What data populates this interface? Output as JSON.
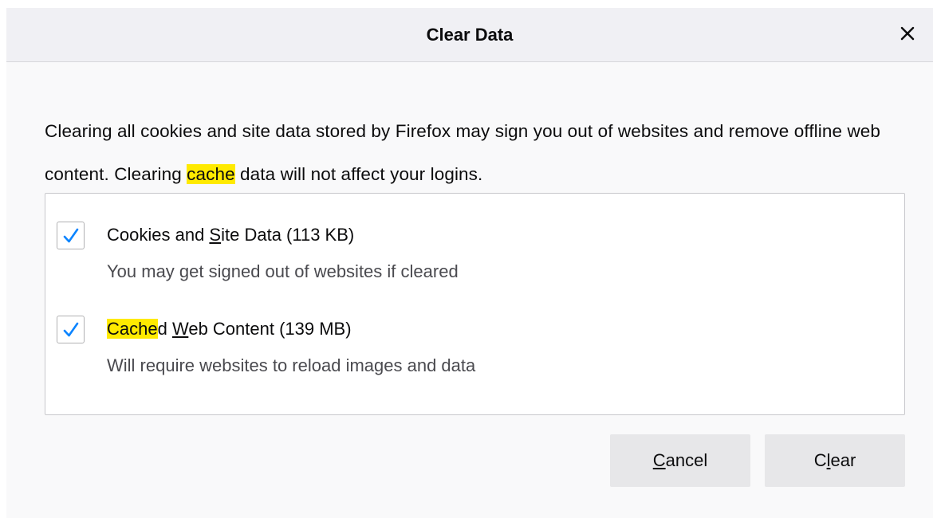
{
  "dialog": {
    "title": "Clear Data",
    "close_icon": "close-icon"
  },
  "description": {
    "part1": "Clearing all cookies and site data stored by Firefox may sign you out of websites and remove offline web content. Clearing ",
    "highlight": "cache",
    "part2": " data will not affect your logins."
  },
  "options": [
    {
      "checked": true,
      "label_pre": "Cookies and ",
      "label_accesskey": "S",
      "label_post": "ite Data (113 KB)",
      "description": "You may get signed out of websites if cleared"
    },
    {
      "checked": true,
      "label_highlight": "Cache",
      "label_pre": "d ",
      "label_accesskey": "W",
      "label_post": "eb Content (139 MB)",
      "description": "Will require websites to reload images and data"
    }
  ],
  "buttons": {
    "cancel": {
      "accesskey": "C",
      "rest": "ancel"
    },
    "clear": {
      "pre": "C",
      "accesskey": "l",
      "rest": "ear"
    }
  },
  "colors": {
    "highlight": "#ffea00",
    "checkmark": "#0a84ff",
    "button_bg": "#e7e7e9",
    "titlebar_bg": "#f0f0f4"
  }
}
